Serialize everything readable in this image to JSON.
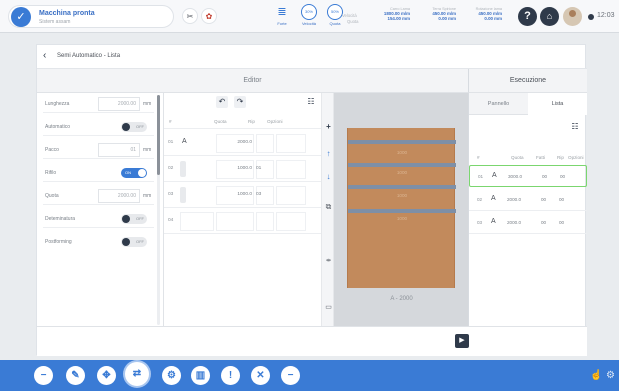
{
  "status": {
    "title": "Macchina pronta",
    "subtitle": "Sistem assam"
  },
  "modes": [
    {
      "label": "Forte",
      "icon": "arm-lines-icon"
    },
    {
      "label": "Velocità",
      "icon": "speed-gauge-icon",
      "badge": "30%"
    },
    {
      "label": "Quota",
      "icon": "quota-gauge-icon",
      "badge": "50%"
    }
  ],
  "readouts": {
    "row_labels": [
      "Velocità",
      "Quota"
    ],
    "columns": [
      {
        "header": "Carro Lama",
        "velocita": "1800.00 m/m",
        "quota": "154.00 mm"
      },
      {
        "header": "Terra Spirione",
        "velocita": "450.00 m/m",
        "quota": "0.00 mm"
      },
      {
        "header": "Rotazione lama",
        "velocita": "450.00 m/m",
        "quota": "0.00 mm"
      }
    ]
  },
  "clock": "12:03",
  "breadcrumb": "Semi Automatico - Lista",
  "editor_title": "Editor",
  "execution_title": "Esecuzione",
  "params": [
    {
      "label": "Lunghezza",
      "value": "2000.00",
      "unit": "mm",
      "kind": "input"
    },
    {
      "label": "Automatico",
      "value": "OFF",
      "kind": "toggle",
      "on": false
    },
    {
      "label": "Pacco",
      "value": "01",
      "unit": "mm",
      "kind": "input"
    },
    {
      "label": "Rifilo",
      "value": "ON",
      "kind": "toggle",
      "on": true
    },
    {
      "label": "Quota",
      "value": "2000.00",
      "unit": "mm",
      "kind": "input"
    },
    {
      "label": "Deteminatura",
      "value": "OFF",
      "kind": "toggle",
      "on": false
    },
    {
      "label": "Postforming",
      "value": "OFF",
      "kind": "toggle",
      "on": false
    }
  ],
  "editor_table": {
    "headers": [
      "#",
      "Quota",
      "Rip",
      "Opzioni"
    ],
    "rows": [
      {
        "n": "01",
        "a": "A",
        "quota": "2000.0",
        "rip": ""
      },
      {
        "n": "02",
        "a": "",
        "quota": "1000.0",
        "rip": "01"
      },
      {
        "n": "03",
        "a": "",
        "quota": "1000.0",
        "rip": "03"
      },
      {
        "n": "04",
        "a": "",
        "quota": "",
        "rip": ""
      }
    ]
  },
  "preview": {
    "caption": "A - 2000",
    "segments": [
      "1000",
      "1000",
      "1000",
      "1000"
    ]
  },
  "exec_tabs": [
    "Pannello",
    "Lista"
  ],
  "exec_table": {
    "headers": [
      "#",
      "Quota",
      "Fatti",
      "Rip",
      "Opzioni"
    ],
    "rows": [
      {
        "n": "01",
        "a": "A",
        "quota": "3000.0",
        "fatti": "00",
        "rip": "00"
      },
      {
        "n": "02",
        "a": "A",
        "quota": "2000.0",
        "fatti": "00",
        "rip": "00"
      },
      {
        "n": "03",
        "a": "A",
        "quota": "2000.0",
        "fatti": "00",
        "rip": "00"
      }
    ]
  },
  "colors": {
    "accent": "#3a7bd5",
    "dark": "#2f3a4a",
    "wood": "#c28a5c",
    "highlight": "#7bd66f"
  }
}
